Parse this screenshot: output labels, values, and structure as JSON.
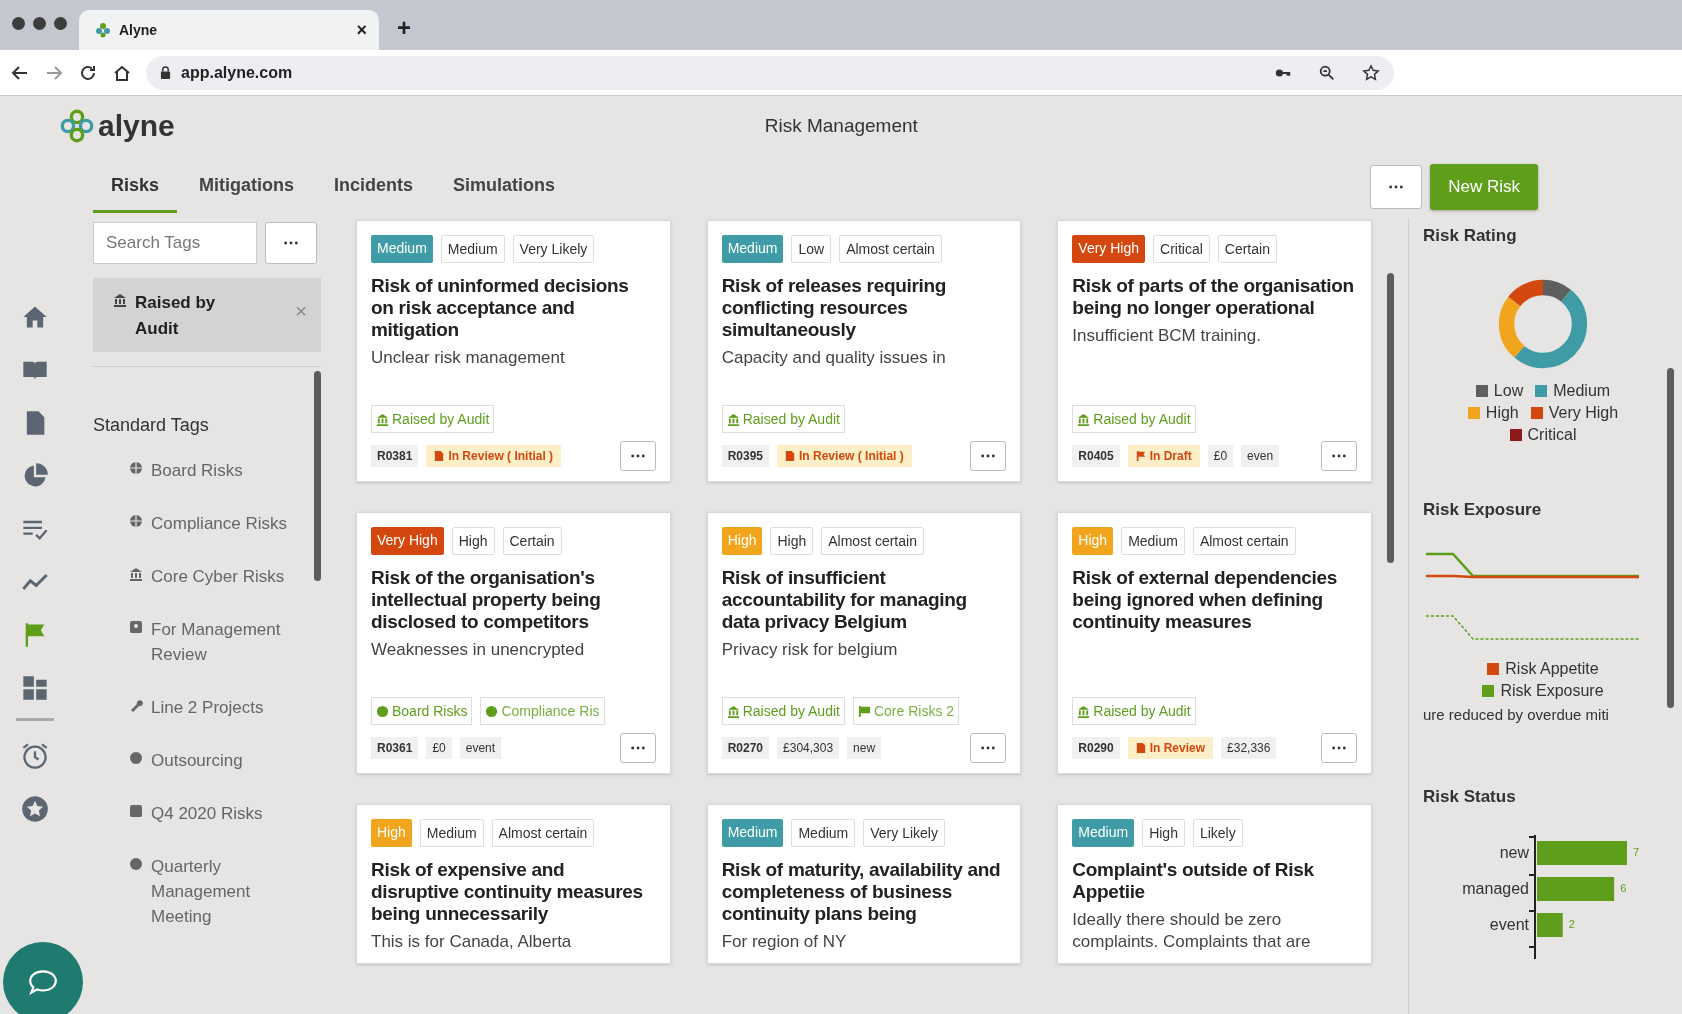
{
  "browser": {
    "tab_title": "Alyne",
    "tab_close": "×",
    "new_tab": "+",
    "url": "app.alyne.com"
  },
  "app": {
    "logo": "alyne",
    "title": "Risk Management"
  },
  "tabs": [
    {
      "label": "Risks",
      "selected": true
    },
    {
      "label": "Mitigations",
      "selected": false
    },
    {
      "label": "Incidents",
      "selected": false
    },
    {
      "label": "Simulations",
      "selected": false
    }
  ],
  "actions": {
    "new_risk": "New Risk"
  },
  "rail": {
    "main": [
      {
        "kind": "home",
        "selected": false
      },
      {
        "kind": "book",
        "selected": false
      },
      {
        "kind": "document",
        "selected": false
      },
      {
        "kind": "pie-chart",
        "selected": false
      },
      {
        "kind": "checklist",
        "selected": false
      },
      {
        "kind": "line-chart",
        "selected": false
      },
      {
        "kind": "flag",
        "selected": true
      },
      {
        "kind": "grid",
        "selected": false
      }
    ],
    "secondary": [
      {
        "kind": "alarm-clock",
        "selected": false
      },
      {
        "kind": "star",
        "selected": false
      }
    ]
  },
  "tag_panel": {
    "search": {
      "placeholder": "Search Tags"
    },
    "active_filters": [
      {
        "label": "Raised by Audit",
        "close": "×"
      }
    ],
    "section": "Standard Tags",
    "tags": [
      {
        "label": "Board Risks",
        "kind": "globe"
      },
      {
        "label": "Compliance Risks",
        "kind": "globe"
      },
      {
        "label": "Core Cyber Risks",
        "kind": "bank"
      },
      {
        "label": "For Management Review",
        "kind": "badge"
      },
      {
        "label": "Line 2 Projects",
        "kind": "wrench"
      },
      {
        "label": "Outsourcing",
        "kind": "dot"
      },
      {
        "label": "Q4 2020 Risks",
        "kind": "square"
      },
      {
        "label": "Quarterly Management Meeting",
        "kind": "dot"
      }
    ]
  },
  "cards": [
    {
      "rating": {
        "label": "Medium",
        "color": "#3f9ca6"
      },
      "impact": "Medium",
      "likelihood": "Very Likely",
      "title": "Risk of uninformed decisions on risk acceptance and mitigation",
      "description": "Unclear risk management",
      "tags": [
        {
          "label": "Raised by Audit",
          "kind": "audit"
        }
      ],
      "id": "R0381",
      "status": {
        "label": "In Review ( Initial )",
        "kind": "review"
      }
    },
    {
      "rating": {
        "label": "Medium",
        "color": "#3f9ca6"
      },
      "impact": "Low",
      "likelihood": "Almost certain",
      "title": "Risk of releases requiring conflicting resources simultaneously",
      "description": "Capacity and quality issues in",
      "tags": [
        {
          "label": "Raised by Audit",
          "kind": "audit"
        }
      ],
      "id": "R0395",
      "status": {
        "label": "In Review ( Initial )",
        "kind": "review"
      }
    },
    {
      "rating": {
        "label": "Very High",
        "color": "#d4480f"
      },
      "impact": "Critical",
      "likelihood": "Certain",
      "title": "Risk of parts of the organisation being no longer operational",
      "description": "Insufficient BCM training.",
      "tags": [
        {
          "label": "Raised by Audit",
          "kind": "audit"
        }
      ],
      "id": "R0405",
      "status": {
        "label": "In Draft",
        "kind": "draft"
      },
      "extras": [
        "£0",
        "even"
      ]
    },
    {
      "rating": {
        "label": "Very High",
        "color": "#d4480f"
      },
      "impact": "High",
      "likelihood": "Certain",
      "title": "Risk of the organisation's intellectual property being disclosed to competitors",
      "description": "Weaknesses in unencrypted",
      "tags": [
        {
          "label": "Board Risks",
          "kind": "globe"
        },
        {
          "label": "Compliance Ris",
          "kind": "globe"
        }
      ],
      "id": "R0361",
      "extras": [
        "£0",
        "event"
      ]
    },
    {
      "rating": {
        "label": "High",
        "color": "#f0a51c"
      },
      "impact": "High",
      "likelihood": "Almost certain",
      "title": "Risk of insufficient accountability for managing data privacy Belgium",
      "description": "Privacy risk for belgium",
      "tags": [
        {
          "label": "Raised by Audit",
          "kind": "audit"
        },
        {
          "label": "Core Risks 2",
          "kind": "flag"
        }
      ],
      "id": "R0270",
      "extras": [
        "£304,303",
        "new"
      ]
    },
    {
      "rating": {
        "label": "High",
        "color": "#f0a51c"
      },
      "impact": "Medium",
      "likelihood": "Almost certain",
      "title": "Risk of external dependencies being ignored when defining continuity measures",
      "tags": [
        {
          "label": "Raised by Audit",
          "kind": "audit"
        }
      ],
      "id": "R0290",
      "status": {
        "label": "In Review",
        "kind": "review"
      },
      "extras": [
        "£32,336"
      ]
    },
    {
      "rating": {
        "label": "High",
        "color": "#f0a51c"
      },
      "impact": "Medium",
      "likelihood": "Almost certain",
      "title": "Risk of expensive and disruptive continuity measures being unnecessarily",
      "description": "This is for Canada, Alberta"
    },
    {
      "rating": {
        "label": "Medium",
        "color": "#3f9ca6"
      },
      "impact": "Medium",
      "likelihood": "Very Likely",
      "title": "Risk of maturity, availability and completeness of business continuity plans being",
      "description": "For region of NY"
    },
    {
      "rating": {
        "label": "Medium",
        "color": "#3f9ca6"
      },
      "impact": "High",
      "likelihood": "Likely",
      "title": "Complaint's outside of Risk Appetiie",
      "description": "Ideally there should be zero complaints. Complaints that are"
    }
  ],
  "risk_rating": {
    "title": "Risk Rating",
    "legend": [
      {
        "label": "Low",
        "color": "#5f5f5f"
      },
      {
        "label": "Medium",
        "color": "#3f9ca6"
      },
      {
        "label": "High",
        "color": "#f0a51c"
      },
      {
        "label": "Very High",
        "color": "#d4480f"
      },
      {
        "label": "Critical",
        "color": "#8c1a1a"
      }
    ]
  },
  "risk_exposure": {
    "title": "Risk Exposure",
    "legend": [
      {
        "label": "Risk Appetite",
        "color": "#d4480f"
      },
      {
        "label": "Risk Exposure",
        "color": "#5f9e1b"
      }
    ],
    "caption": "ure reduced by overdue miti"
  },
  "risk_status": {
    "chart_data": {
      "type": "bar",
      "orientation": "horizontal",
      "title": "Risk Status",
      "categories": [
        "new",
        "managed",
        "event"
      ],
      "values": [
        7,
        6,
        2
      ],
      "data_labels": true
    }
  }
}
